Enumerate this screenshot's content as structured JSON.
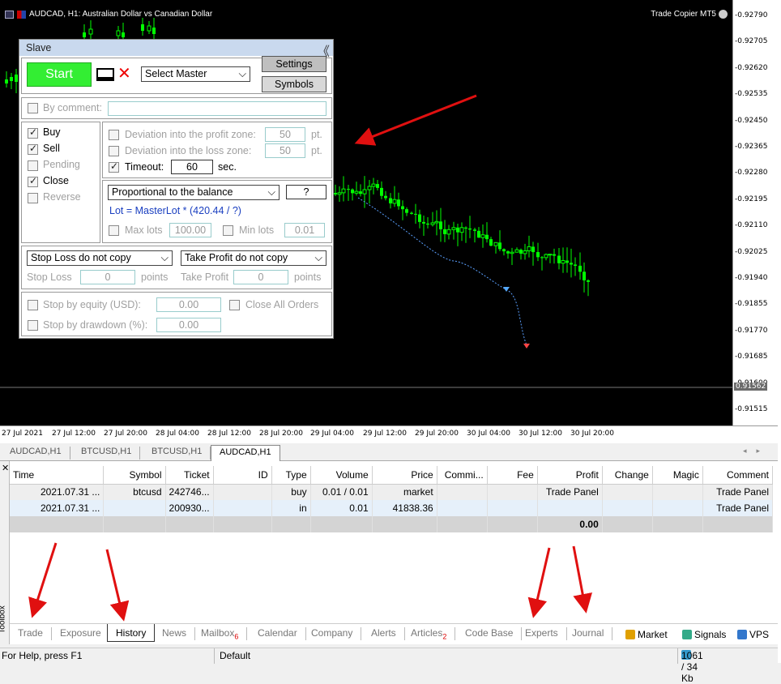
{
  "chart": {
    "title": "AUDCAD, H1:  Australian Dollar vs Canadian Dollar",
    "copier_label": "Trade Copier MT5",
    "current_price": "0.91562",
    "y_ticks": [
      "0.92790",
      "0.92705",
      "0.92620",
      "0.92535",
      "0.92450",
      "0.92365",
      "0.92280",
      "0.92195",
      "0.92110",
      "0.92025",
      "0.91940",
      "0.91855",
      "0.91770",
      "0.91685",
      "0.91600",
      "0.91515"
    ],
    "x_ticks": [
      "27 Jul 2021",
      "27 Jul 12:00",
      "27 Jul 20:00",
      "28 Jul 04:00",
      "28 Jul 12:00",
      "28 Jul 20:00",
      "29 Jul 04:00",
      "29 Jul 12:00",
      "29 Jul 20:00",
      "30 Jul 04:00",
      "30 Jul 12:00",
      "30 Jul 20:00"
    ],
    "colors": {
      "bull": "#00ff00",
      "bear": "#00ff00",
      "background": "#000000"
    }
  },
  "chart_tabs": [
    "AUDCAD,H1",
    "BTCUSD,H1",
    "BTCUSD,H1",
    "AUDCAD,H1"
  ],
  "slave": {
    "title": "Slave",
    "collapse": "《",
    "start": "Start",
    "select_master": "Select Master",
    "settings": "Settings",
    "symbols": "Symbols",
    "by_comment": "By comment:",
    "buy": "Buy",
    "sell": "Sell",
    "pending": "Pending",
    "close": "Close",
    "reverse": "Reverse",
    "dev_profit": "Deviation into the profit zone:",
    "dev_profit_val": "50",
    "dev_loss": "Deviation into the loss zone:",
    "dev_loss_val": "50",
    "pt": "pt.",
    "timeout": "Timeout:",
    "timeout_val": "60",
    "sec": "sec.",
    "lot_mode": "Proportional to the balance",
    "help": "?",
    "lot_formula": "Lot = MasterLot * (420.44 / ?)",
    "max_lots": "Max lots",
    "max_lots_val": "100.00",
    "min_lots": "Min lots",
    "min_lots_val": "0.01",
    "sl_mode": "Stop Loss do not copy",
    "tp_mode": "Take Profit do not copy",
    "stop_loss": "Stop Loss",
    "sl_val": "0",
    "take_profit": "Take Profit",
    "tp_val": "0",
    "points": "points",
    "stop_equity": "Stop by equity (USD):",
    "stop_equity_val": "0.00",
    "close_all": "Close All Orders",
    "stop_dd": "Stop by drawdown (%):",
    "stop_dd_val": "0.00"
  },
  "toolbox": {
    "close": "✕",
    "side_label": "Toolbox",
    "columns": [
      "Time",
      "Symbol",
      "Ticket",
      "ID",
      "Type",
      "Volume",
      "Price",
      "Commi...",
      "Fee",
      "Profit",
      "Change",
      "Magic",
      "Comment"
    ],
    "rows": [
      [
        "2021.07.31 ...",
        "btcusd",
        "242746...",
        "",
        "buy",
        "0.01 / 0.01",
        "market",
        "",
        "",
        "Trade Panel",
        "",
        "",
        "Trade Panel"
      ],
      [
        "2021.07.31 ...",
        "",
        "200930...",
        "",
        "in",
        "0.01",
        "41838.36",
        "",
        "",
        "",
        "",
        "",
        "Trade Panel"
      ]
    ],
    "total": "0.00",
    "tabs": [
      "Trade",
      "Exposure",
      "History",
      "News",
      "Mailbox",
      "Calendar",
      "Company",
      "Alerts",
      "Articles",
      "Code Base",
      "Experts",
      "Journal"
    ],
    "mailbox_count": "6",
    "articles_count": "2",
    "market": "Market",
    "signals": "Signals",
    "vps": "VPS"
  },
  "status": {
    "help": "For Help, press F1",
    "profile": "Default",
    "traffic": "1061 / 34 Kb"
  }
}
